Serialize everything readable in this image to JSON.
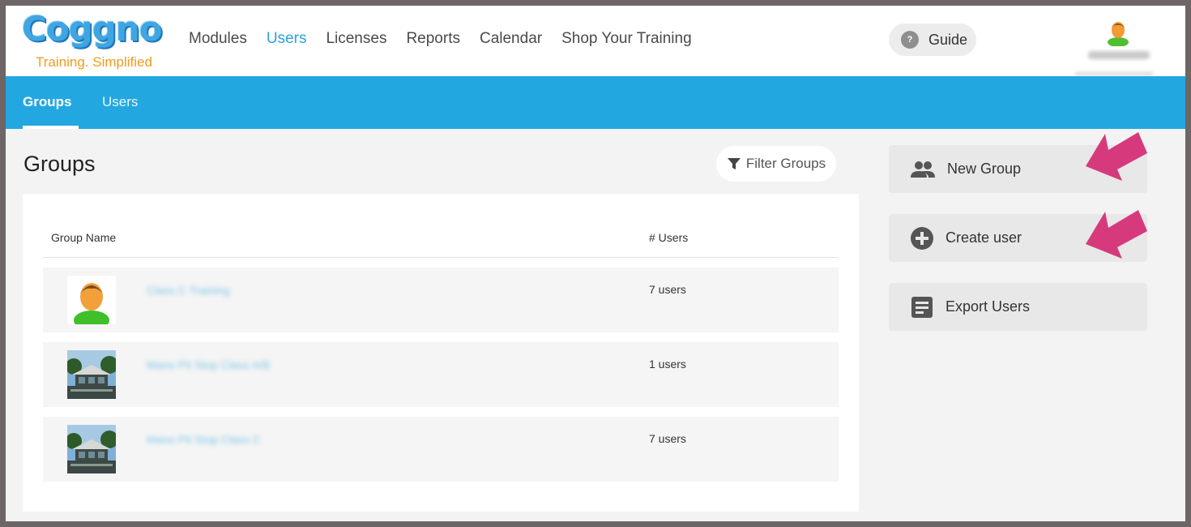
{
  "header": {
    "logo_word": "Coggno",
    "logo_tagline": "Training. Simplified",
    "nav": [
      {
        "label": "Modules"
      },
      {
        "label": "Users"
      },
      {
        "label": "Licenses"
      },
      {
        "label": "Reports"
      },
      {
        "label": "Calendar"
      },
      {
        "label": "Shop Your Training"
      }
    ],
    "active_nav": "Users",
    "guide_label": "Guide",
    "guide_icon_glyph": "?",
    "profile_avatar_icon": "user-avatar-icon"
  },
  "subnav": {
    "tabs": [
      {
        "label": "Groups"
      },
      {
        "label": "Users"
      }
    ],
    "active_tab": "Groups"
  },
  "main": {
    "title": "Groups",
    "filter_label": "Filter Groups",
    "table": {
      "columns": [
        "Group Name",
        "# Users"
      ],
      "rows": [
        {
          "name": "Class C Training",
          "users": "7 users",
          "thumb": "user-avatar-icon"
        },
        {
          "name": "Mano Pit Stop Class A/B",
          "users": "1 users",
          "thumb": "building-photo"
        },
        {
          "name": "Mano Pit Stop Class C",
          "users": "7 users",
          "thumb": "building-photo"
        }
      ]
    }
  },
  "sidebar": {
    "buttons": [
      {
        "label": "New Group",
        "icon": "people-icon"
      },
      {
        "label": "Create user",
        "icon": "plus-circle-icon"
      },
      {
        "label": "Export Users",
        "icon": "document-icon"
      }
    ]
  },
  "colors": {
    "brand_blue": "#23a7e0",
    "active_link": "#2aa3dc",
    "logo_orange": "#f39a1e",
    "annotation_arrow": "#d63a7d",
    "frame": "#6e6566"
  }
}
